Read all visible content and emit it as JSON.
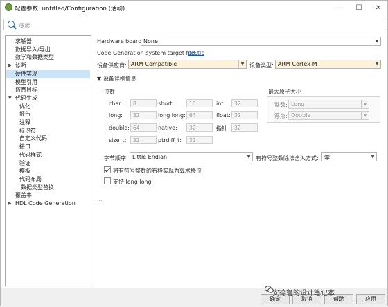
{
  "window": {
    "title": "配置参数: untitled/Configuration (活动)",
    "minimize": "—",
    "maximize": "☐",
    "close": "✕"
  },
  "search": {
    "placeholder": "搜索"
  },
  "tree": [
    {
      "label": "求解器",
      "level": 1
    },
    {
      "label": "数据导入/导出",
      "level": 1
    },
    {
      "label": "数学和数据类型",
      "level": 1
    },
    {
      "label": "诊断",
      "level": 0,
      "arrow": "▶"
    },
    {
      "label": "硬件实现",
      "level": 1,
      "selected": true
    },
    {
      "label": "模型引用",
      "level": 1
    },
    {
      "label": "仿真目标",
      "level": 1
    },
    {
      "label": "代码生成",
      "level": 0,
      "arrow": "▼"
    },
    {
      "label": "优化",
      "level": 2
    },
    {
      "label": "报告",
      "level": 2
    },
    {
      "label": "注释",
      "level": 2
    },
    {
      "label": "标识符",
      "level": 2
    },
    {
      "label": "自定义代码",
      "level": 2
    },
    {
      "label": "接口",
      "level": 2
    },
    {
      "label": "代码样式",
      "level": 2
    },
    {
      "label": "验证",
      "level": 2
    },
    {
      "label": "模板",
      "level": 2
    },
    {
      "label": "代码布局",
      "level": 2
    },
    {
      "label": "数据类型替换",
      "level": 3
    },
    {
      "label": "覆盖率",
      "level": 1
    },
    {
      "label": "HDL Code Generation",
      "level": 0,
      "arrow": "▶"
    }
  ],
  "hardware": {
    "board_label": "Hardware board:",
    "board_value": "None",
    "target_file_label": "Code Generation system target file:",
    "target_file_link": "ert.tlc",
    "vendor_label": "设备供应商:",
    "vendor_value": "ARM Compatible",
    "type_label": "设备类型:",
    "type_value": "ARM Cortex-M",
    "details_toggle": "▼ 设备详细信息",
    "bits_title": "位数",
    "bits": [
      {
        "label": "char:",
        "value": "8"
      },
      {
        "label": "short:",
        "value": "16"
      },
      {
        "label": "int:",
        "value": "32"
      },
      {
        "label": "long:",
        "value": "32"
      },
      {
        "label": "long long:",
        "value": "64"
      },
      {
        "label": "float:",
        "value": "32"
      },
      {
        "label": "double:",
        "value": "64"
      },
      {
        "label": "native:",
        "value": "32"
      },
      {
        "label": "指针:",
        "value": "32"
      },
      {
        "label": "size_t:",
        "value": "32"
      },
      {
        "label": "ptrdiff_t:",
        "value": "32"
      }
    ],
    "atomic_title": "最大原子大小",
    "atomic_int_label": "整数:",
    "atomic_int_value": "Long",
    "atomic_float_label": "浮点:",
    "atomic_float_value": "Double",
    "byte_order_label": "字节顺序:",
    "byte_order_value": "Little Endian",
    "rounding_label": "有符号整数除法舍入方式:",
    "rounding_value": "零",
    "shift_label": "将有符号整数的右移实现为算术移位",
    "shift_checked": true,
    "longlong_label": "支持 long long",
    "longlong_checked": false,
    "ellipsis": "..."
  },
  "footer": {
    "ok": "确定",
    "cancel": "取消",
    "help": "帮助",
    "apply": "应用"
  },
  "watermark": "安德鲁的设计笔记本"
}
